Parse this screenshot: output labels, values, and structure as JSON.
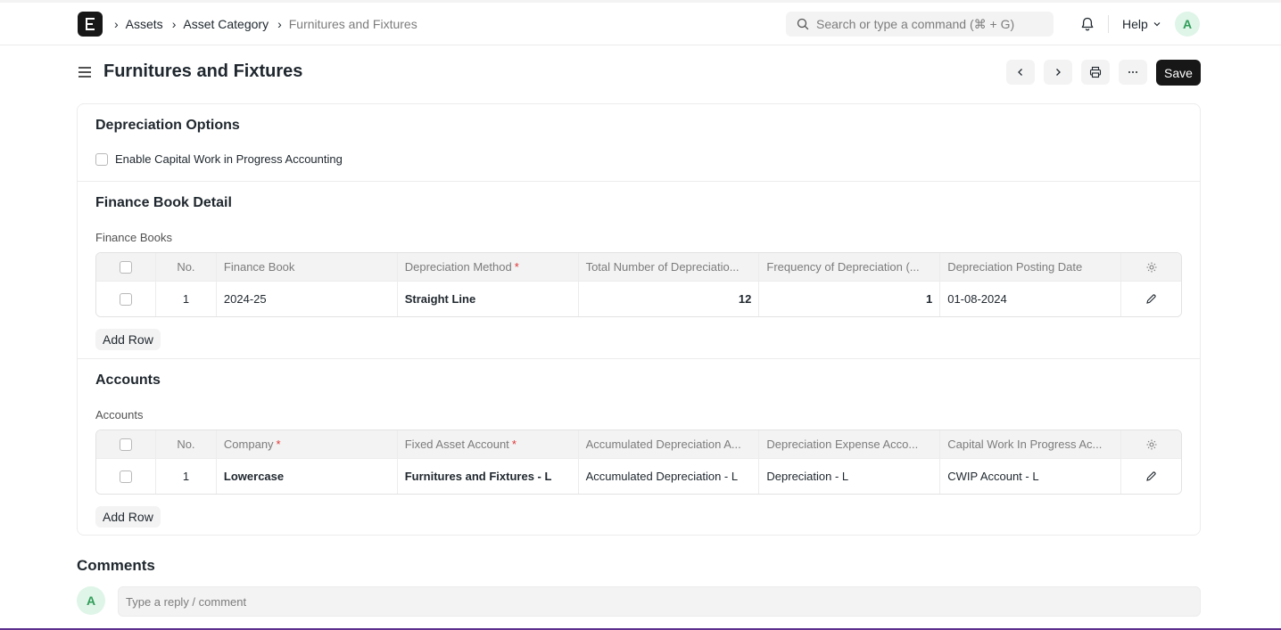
{
  "navbar": {
    "logo_letter": "E",
    "breadcrumbs": [
      "Assets",
      "Asset Category",
      "Furnitures and Fixtures"
    ],
    "search_placeholder": "Search or type a command (⌘ + G)",
    "help_label": "Help",
    "avatar_initial": "A"
  },
  "page": {
    "title": "Furnitures and Fixtures",
    "save_label": "Save"
  },
  "sections": {
    "depreciation_options": {
      "title": "Depreciation Options",
      "checkbox_label": "Enable Capital Work in Progress Accounting",
      "checked": false
    },
    "finance_book_detail": {
      "title": "Finance Book Detail",
      "table_label": "Finance Books",
      "columns": [
        "No.",
        "Finance Book",
        "Depreciation Method",
        "Total Number of Depreciatio...",
        "Frequency of Depreciation (...",
        "Depreciation Posting Date"
      ],
      "rows": [
        {
          "no": "1",
          "finance_book": "2024-25",
          "method": "Straight Line",
          "total": "12",
          "frequency": "1",
          "posting_date": "01-08-2024"
        }
      ],
      "add_row_label": "Add Row"
    },
    "accounts": {
      "title": "Accounts",
      "table_label": "Accounts",
      "columns": [
        "No.",
        "Company",
        "Fixed Asset Account",
        "Accumulated Depreciation A...",
        "Depreciation Expense Acco...",
        "Capital Work In Progress Ac..."
      ],
      "rows": [
        {
          "no": "1",
          "company": "Lowercase",
          "fixed_asset": "Furnitures and Fixtures - L",
          "accumulated": "Accumulated Depreciation - L",
          "expense": "Depreciation - L",
          "cwip": "CWIP Account - L"
        }
      ],
      "add_row_label": "Add Row"
    }
  },
  "comments": {
    "title": "Comments",
    "avatar_initial": "A",
    "placeholder": "Type a reply / comment"
  },
  "colors": {
    "accent": "#171717",
    "required": "#e03636",
    "avatar_bg": "#dff5e8",
    "avatar_fg": "#2f9d58"
  }
}
